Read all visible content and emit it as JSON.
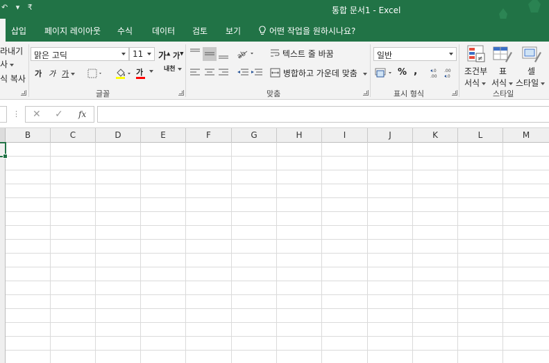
{
  "titlebar": {
    "quick_access": "↶ ▾ ₹",
    "title": "통합 문서1  -  Excel"
  },
  "tabs": [
    {
      "label": "삽입"
    },
    {
      "label": "페이지 레이아웃"
    },
    {
      "label": "수식"
    },
    {
      "label": "데이터"
    },
    {
      "label": "검토"
    },
    {
      "label": "보기"
    }
  ],
  "tell_me": "어떤 작업을 원하시나요?",
  "clipboard": {
    "paste_partial": "라내기",
    "copy_partial": "사",
    "format_painter_partial": "식 복사"
  },
  "font": {
    "font_name": "맑은 고딕",
    "font_size": "11",
    "grow": "가",
    "shrink": "가",
    "bold": "가",
    "italic": "가",
    "underline": "가",
    "font_color_glyph": "가",
    "phonetic": "내천",
    "label": "글꼴"
  },
  "alignment": {
    "wrap_text": "텍스트 줄 바꿈",
    "merge_center": "병합하고 가운데 맞춤",
    "label": "맞춤"
  },
  "number": {
    "format": "일반",
    "percent": "%",
    "comma": ",",
    "inc_decimal": ".0←.00",
    "dec_decimal": ".00→.0",
    "label": "표시 형식"
  },
  "styles": {
    "conditional": "조건부\n서식",
    "conditional_line1": "조건부",
    "conditional_line2": "서식",
    "table_line1": "표",
    "table_line2": "서식",
    "cell_line1": "셀",
    "cell_line2": "스타일",
    "label": "스타일"
  },
  "formula_bar": {
    "cancel": "✕",
    "enter": "✓",
    "fx": "fx",
    "value": ""
  },
  "columns": [
    "B",
    "C",
    "D",
    "E",
    "F",
    "G",
    "H",
    "I",
    "J",
    "K",
    "L",
    "M"
  ],
  "colors": {
    "excel_green": "#217346",
    "ribbon_bg": "#f3f3f3",
    "fill_yellow": "#ffff00",
    "font_red": "#ff0000"
  }
}
